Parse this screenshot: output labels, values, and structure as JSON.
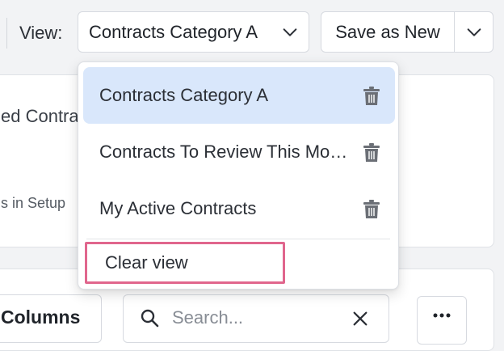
{
  "toolbar": {
    "view_label": "View:",
    "view_select_value": "Contracts Category A",
    "save_as_new_label": "Save as New"
  },
  "background": {
    "card_title_partial": "ed Contra",
    "card_sub_partial": "s in Setup",
    "columns_label": "Columns",
    "search_placeholder": "Search...",
    "more_label": "•••"
  },
  "dropdown": {
    "items": [
      {
        "label": "Contracts Category A",
        "selected": true
      },
      {
        "label": "Contracts To Review This Month",
        "selected": false
      },
      {
        "label": "My Active Contracts",
        "selected": false
      }
    ],
    "clear_view_label": "Clear view"
  },
  "colors": {
    "selected_bg": "#d9e7fb",
    "highlight_border": "#e0668d",
    "icon_gray": "#6b6f76"
  }
}
